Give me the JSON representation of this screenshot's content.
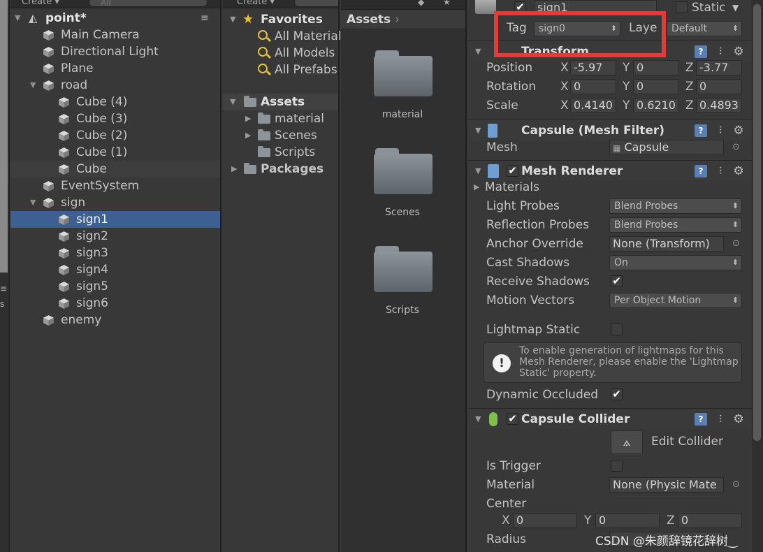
{
  "hierarchy": {
    "create_label": "Create ▾",
    "search_placeholder": "All",
    "scene_name": "point*",
    "menu_icon": "≡",
    "items": [
      {
        "label": "Main Camera",
        "indent": 0
      },
      {
        "label": "Directional Light",
        "indent": 0
      },
      {
        "label": "Plane",
        "indent": 0
      },
      {
        "label": "road",
        "indent": 0,
        "expanded": true
      },
      {
        "label": "Cube (4)",
        "indent": 1
      },
      {
        "label": "Cube (3)",
        "indent": 1
      },
      {
        "label": "Cube (2)",
        "indent": 1
      },
      {
        "label": "Cube (1)",
        "indent": 1
      },
      {
        "label": "Cube",
        "indent": 1
      },
      {
        "label": "EventSystem",
        "indent": 0
      },
      {
        "label": "sign",
        "indent": 0,
        "expanded": true
      },
      {
        "label": "sign1",
        "indent": 1,
        "selected": true
      },
      {
        "label": "sign2",
        "indent": 1
      },
      {
        "label": "sign3",
        "indent": 1
      },
      {
        "label": "sign4",
        "indent": 1
      },
      {
        "label": "sign5",
        "indent": 1
      },
      {
        "label": "sign6",
        "indent": 1
      },
      {
        "label": "enemy",
        "indent": 0
      }
    ]
  },
  "project": {
    "create_label": "Create ▾",
    "favorites_label": "Favorites",
    "favorites": [
      "All Material",
      "All Models",
      "All Prefabs"
    ],
    "assets_label": "Assets",
    "asset_folders": [
      "material",
      "Scenes",
      "Scripts"
    ],
    "packages_label": "Packages",
    "breadcrumb": "Assets",
    "grid_folders": [
      "material",
      "Scenes",
      "Scripts"
    ]
  },
  "inspector": {
    "object_name": "sign1",
    "static_label": "Static",
    "tag_label": "Tag",
    "tag_value": "sign0",
    "layer_label": "Laye",
    "layer_value": "Default",
    "transform_title": "Transform",
    "position": {
      "label": "Position",
      "x": "-5.97",
      "y": "0",
      "z": "-3.77"
    },
    "rotation": {
      "label": "Rotation",
      "x": "0",
      "y": "0",
      "z": "0"
    },
    "scale": {
      "label": "Scale",
      "x": "0.4140",
      "y": "0.6210",
      "z": "0.4893"
    },
    "axis_x": "X",
    "axis_y": "Y",
    "axis_z": "Z",
    "mesh_filter_title": "Capsule (Mesh Filter)",
    "mesh_label": "Mesh",
    "mesh_value": "Capsule",
    "mesh_renderer_title": "Mesh Renderer",
    "materials_label": "Materials",
    "light_probes_label": "Light Probes",
    "light_probes_value": "Blend Probes",
    "reflection_probes_label": "Reflection Probes",
    "reflection_probes_value": "Blend Probes",
    "anchor_override_label": "Anchor Override",
    "anchor_override_value": "None (Transform)",
    "cast_shadows_label": "Cast Shadows",
    "cast_shadows_value": "On",
    "receive_shadows_label": "Receive Shadows",
    "motion_vectors_label": "Motion Vectors",
    "motion_vectors_value": "Per Object Motion",
    "lightmap_static_label": "Lightmap Static",
    "lightmap_info": "To enable generation of lightmaps for this Mesh Renderer, please enable the 'Lightmap Static' property.",
    "dynamic_occluded_label": "Dynamic Occluded",
    "capsule_collider_title": "Capsule Collider",
    "edit_collider_label": "Edit Collider",
    "is_trigger_label": "Is Trigger",
    "material_label": "Material",
    "material_value": "None (Physic Mate",
    "center_label": "Center",
    "center": {
      "x": "0",
      "y": "0",
      "z": "0"
    },
    "radius_label": "Radius"
  },
  "watermark": "CSDN @朱颜辞镜花辞树‿",
  "colors": {
    "selection": "#3d5f92",
    "highlight_box": "#e03c3c",
    "panel": "#383838"
  }
}
